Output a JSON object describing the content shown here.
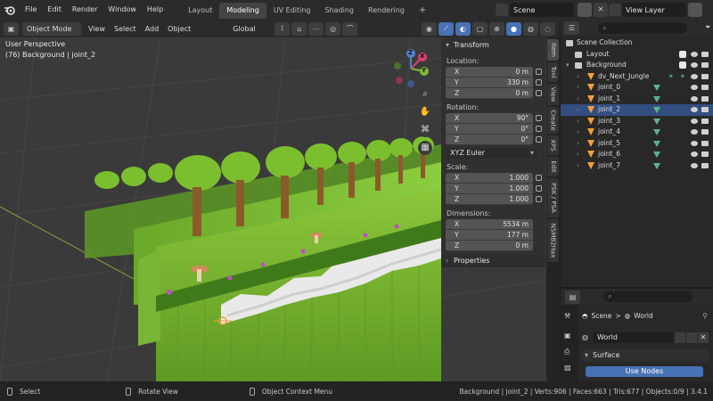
{
  "menus": [
    "File",
    "Edit",
    "Render",
    "Window",
    "Help"
  ],
  "workspaces": [
    {
      "label": "Layout",
      "active": false
    },
    {
      "label": "Modeling",
      "active": true
    },
    {
      "label": "UV Editing",
      "active": false
    },
    {
      "label": "Shading",
      "active": false
    },
    {
      "label": "Rendering",
      "active": false
    }
  ],
  "add_workspace": "+",
  "scene_name": "Scene",
  "view_layer": "View Layer",
  "viewport": {
    "mode": "Object Mode",
    "menu": [
      "View",
      "Select",
      "Add",
      "Object"
    ],
    "orientation": "Global",
    "perspective_label": "User Perspective",
    "context_label": "(76) Background | joint_2",
    "gizmo": {
      "x": "X",
      "y": "Y",
      "z": "Z"
    }
  },
  "transform": {
    "title": "Transform",
    "location_label": "Location:",
    "location": [
      {
        "axis": "X",
        "value": "0 m"
      },
      {
        "axis": "Y",
        "value": "330 m"
      },
      {
        "axis": "Z",
        "value": "0 m"
      }
    ],
    "rotation_label": "Rotation:",
    "rotation": [
      {
        "axis": "X",
        "value": "90°"
      },
      {
        "axis": "Y",
        "value": "0°"
      },
      {
        "axis": "Z",
        "value": "0°"
      }
    ],
    "rotation_mode": "XYZ Euler",
    "scale_label": "Scale:",
    "scale": [
      {
        "axis": "X",
        "value": "1.000"
      },
      {
        "axis": "Y",
        "value": "1.000"
      },
      {
        "axis": "Z",
        "value": "1.000"
      }
    ],
    "dimensions_label": "Dimensions:",
    "dimensions": [
      {
        "axis": "X",
        "value": "5534 m"
      },
      {
        "axis": "Y",
        "value": "177 m"
      },
      {
        "axis": "Z",
        "value": "0 m"
      }
    ],
    "properties_label": "Properties"
  },
  "side_tabs": [
    {
      "label": "Item",
      "active": true
    },
    {
      "label": "Tool",
      "active": false
    },
    {
      "label": "View",
      "active": false
    },
    {
      "label": "Create",
      "active": false
    },
    {
      "label": "XPS",
      "active": false
    },
    {
      "label": "Edit",
      "active": false
    },
    {
      "label": "PSK / PSA",
      "active": false
    },
    {
      "label": "NSMB2Hax",
      "active": false
    }
  ],
  "outliner": {
    "scene_collection": "Scene Collection",
    "collections": [
      {
        "name": "Layout",
        "icon_color": "#d0d0d0"
      },
      {
        "name": "Background",
        "icon_color": "#d0d0d0"
      }
    ],
    "armature": "dv_Next_Jungle",
    "joints": [
      "joint_0",
      "joint_1",
      "joint_2",
      "joint_3",
      "joint_4",
      "joint_5",
      "joint_6",
      "joint_7"
    ],
    "selected": "joint_2"
  },
  "properties": {
    "breadcrumb_scene": "Scene",
    "breadcrumb_sep": ">",
    "breadcrumb_world": "World",
    "world_name": "World",
    "surface_label": "Surface",
    "use_nodes_label": "Use Nodes"
  },
  "status": {
    "select": "Select",
    "rotate": "Rotate View",
    "context_menu": "Object Context Menu",
    "stats": "Background | joint_2 | Verts:906 | Faces:663 | Tris:677 | Objects:0/9 | 3.4.1"
  },
  "colors": {
    "accent": "#4772b3",
    "selection": "#334d80",
    "grass": "#7ab833",
    "armature_orange": "#f2a03c"
  }
}
